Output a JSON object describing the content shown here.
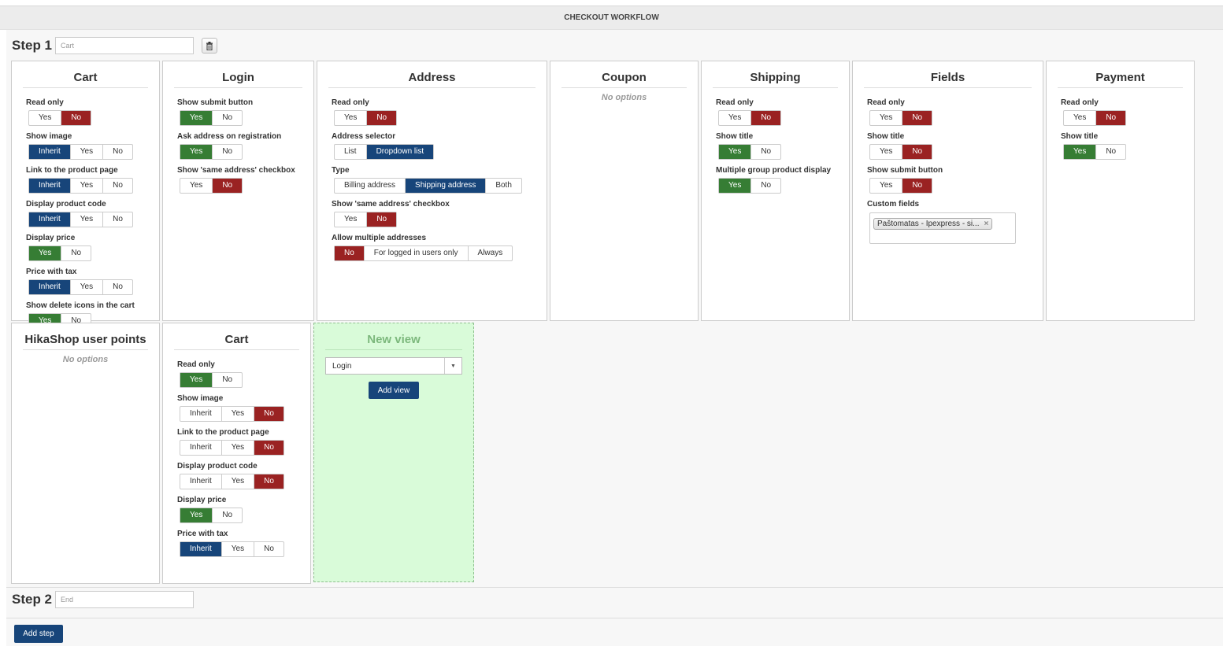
{
  "header": {
    "title": "CHECKOUT WORKFLOW"
  },
  "steps": [
    {
      "label": "Step 1",
      "placeholder": "Cart"
    },
    {
      "label": "Step 2",
      "placeholder": "End"
    }
  ],
  "panels": {
    "cart1": {
      "title": "Cart",
      "options": [
        {
          "label": "Read only",
          "buttons": [
            "Yes",
            "No"
          ]
        },
        {
          "label": "Show image",
          "buttons": [
            "Inherit",
            "Yes",
            "No"
          ]
        },
        {
          "label": "Link to the product page",
          "buttons": [
            "Inherit",
            "Yes",
            "No"
          ]
        },
        {
          "label": "Display product code",
          "buttons": [
            "Inherit",
            "Yes",
            "No"
          ]
        },
        {
          "label": "Display price",
          "buttons": [
            "Yes",
            "No"
          ]
        },
        {
          "label": "Price with tax",
          "buttons": [
            "Inherit",
            "Yes",
            "No"
          ]
        },
        {
          "label": "Show delete icons in the cart",
          "buttons": [
            "Yes",
            "No"
          ]
        }
      ]
    },
    "login": {
      "title": "Login",
      "options": [
        {
          "label": "Show submit button",
          "buttons": [
            "Yes",
            "No"
          ]
        },
        {
          "label": "Ask address on registration",
          "buttons": [
            "Yes",
            "No"
          ]
        },
        {
          "label": "Show 'same address' checkbox",
          "buttons": [
            "Yes",
            "No"
          ]
        }
      ]
    },
    "address": {
      "title": "Address",
      "options": [
        {
          "label": "Read only",
          "buttons": [
            "Yes",
            "No"
          ]
        },
        {
          "label": "Address selector",
          "buttons": [
            "List",
            "Dropdown list"
          ]
        },
        {
          "label": "Type",
          "buttons": [
            "Billing address",
            "Shipping address",
            "Both"
          ]
        },
        {
          "label": "Show 'same address' checkbox",
          "buttons": [
            "Yes",
            "No"
          ]
        },
        {
          "label": "Allow multiple addresses",
          "buttons": [
            "No",
            "For logged in users only",
            "Always"
          ]
        }
      ]
    },
    "coupon": {
      "title": "Coupon",
      "no_options": "No options"
    },
    "shipping": {
      "title": "Shipping",
      "options": [
        {
          "label": "Read only",
          "buttons": [
            "Yes",
            "No"
          ]
        },
        {
          "label": "Show title",
          "buttons": [
            "Yes",
            "No"
          ]
        },
        {
          "label": "Multiple group product display",
          "buttons": [
            "Yes",
            "No"
          ]
        }
      ]
    },
    "fields": {
      "title": "Fields",
      "options": [
        {
          "label": "Read only",
          "buttons": [
            "Yes",
            "No"
          ]
        },
        {
          "label": "Show title",
          "buttons": [
            "Yes",
            "No"
          ]
        },
        {
          "label": "Show submit button",
          "buttons": [
            "Yes",
            "No"
          ]
        }
      ],
      "custom_fields_label": "Custom fields",
      "custom_field_tag": "Paštomatas - Ipexpress - si..."
    },
    "payment": {
      "title": "Payment",
      "options": [
        {
          "label": "Read only",
          "buttons": [
            "Yes",
            "No"
          ]
        },
        {
          "label": "Show title",
          "buttons": [
            "Yes",
            "No"
          ]
        }
      ]
    },
    "userpoints": {
      "title": "HikaShop user points",
      "no_options": "No options"
    },
    "cart2": {
      "title": "Cart",
      "options": [
        {
          "label": "Read only",
          "buttons": [
            "Yes",
            "No"
          ]
        },
        {
          "label": "Show image",
          "buttons": [
            "Inherit",
            "Yes",
            "No"
          ]
        },
        {
          "label": "Link to the product page",
          "buttons": [
            "Inherit",
            "Yes",
            "No"
          ]
        },
        {
          "label": "Display product code",
          "buttons": [
            "Inherit",
            "Yes",
            "No"
          ]
        },
        {
          "label": "Display price",
          "buttons": [
            "Yes",
            "No"
          ]
        },
        {
          "label": "Price with tax",
          "buttons": [
            "Inherit",
            "Yes",
            "No"
          ]
        }
      ]
    }
  },
  "new_view": {
    "title": "New view",
    "selected": "Login",
    "add_button": "Add view"
  },
  "add_step_button": "Add step",
  "colors": {
    "red": "#9a2222",
    "green": "#367d34",
    "blue": "#17457a",
    "new_view_bg": "#d9fbd9"
  }
}
